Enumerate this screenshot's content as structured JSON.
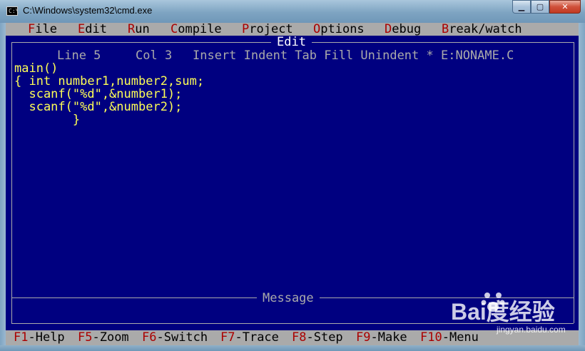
{
  "window": {
    "title": "C:\\Windows\\system32\\cmd.exe",
    "icon_text": "C:\\",
    "controls": {
      "minimize": "▁",
      "maximize": "▢",
      "close": "✕"
    }
  },
  "menu": {
    "items": [
      {
        "hot": "F",
        "rest": "ile"
      },
      {
        "hot": "E",
        "rest": "dit"
      },
      {
        "hot": "R",
        "rest": "un"
      },
      {
        "hot": "C",
        "rest": "ompile"
      },
      {
        "hot": "P",
        "rest": "roject"
      },
      {
        "hot": "O",
        "rest": "ptions"
      },
      {
        "hot": "D",
        "rest": "ebug"
      },
      {
        "hot": "B",
        "rest": "reak/watch"
      }
    ]
  },
  "edit_panel": {
    "title": "Edit",
    "status": {
      "line": "Line 5",
      "col": "Col 3",
      "flags": "Insert Indent Tab Fill Unindent * E:NONAME.C"
    },
    "code_lines": [
      "main()",
      "{ int number1,number2,sum;",
      "  scanf(\"%d\",&number1);",
      "  scanf(\"%d\",&number2);",
      "",
      "        }"
    ]
  },
  "message_panel": {
    "title": "Message"
  },
  "function_keys": [
    {
      "key": "F1",
      "label": "-Help"
    },
    {
      "key": "F5",
      "label": "-Zoom"
    },
    {
      "key": "F6",
      "label": "-Switch"
    },
    {
      "key": "F7",
      "label": "-Trace"
    },
    {
      "key": "F8",
      "label": "-Step"
    },
    {
      "key": "F9",
      "label": "-Make"
    },
    {
      "key": "F10",
      "label": "-Menu"
    }
  ],
  "watermark": {
    "main": "Bai度经验",
    "sub": "jingyan.baidu.com"
  },
  "colors": {
    "editor_bg": "#000080",
    "code_text": "#ffff55",
    "menu_bg": "#aaaaaa",
    "hotkey": "#aa0000"
  }
}
